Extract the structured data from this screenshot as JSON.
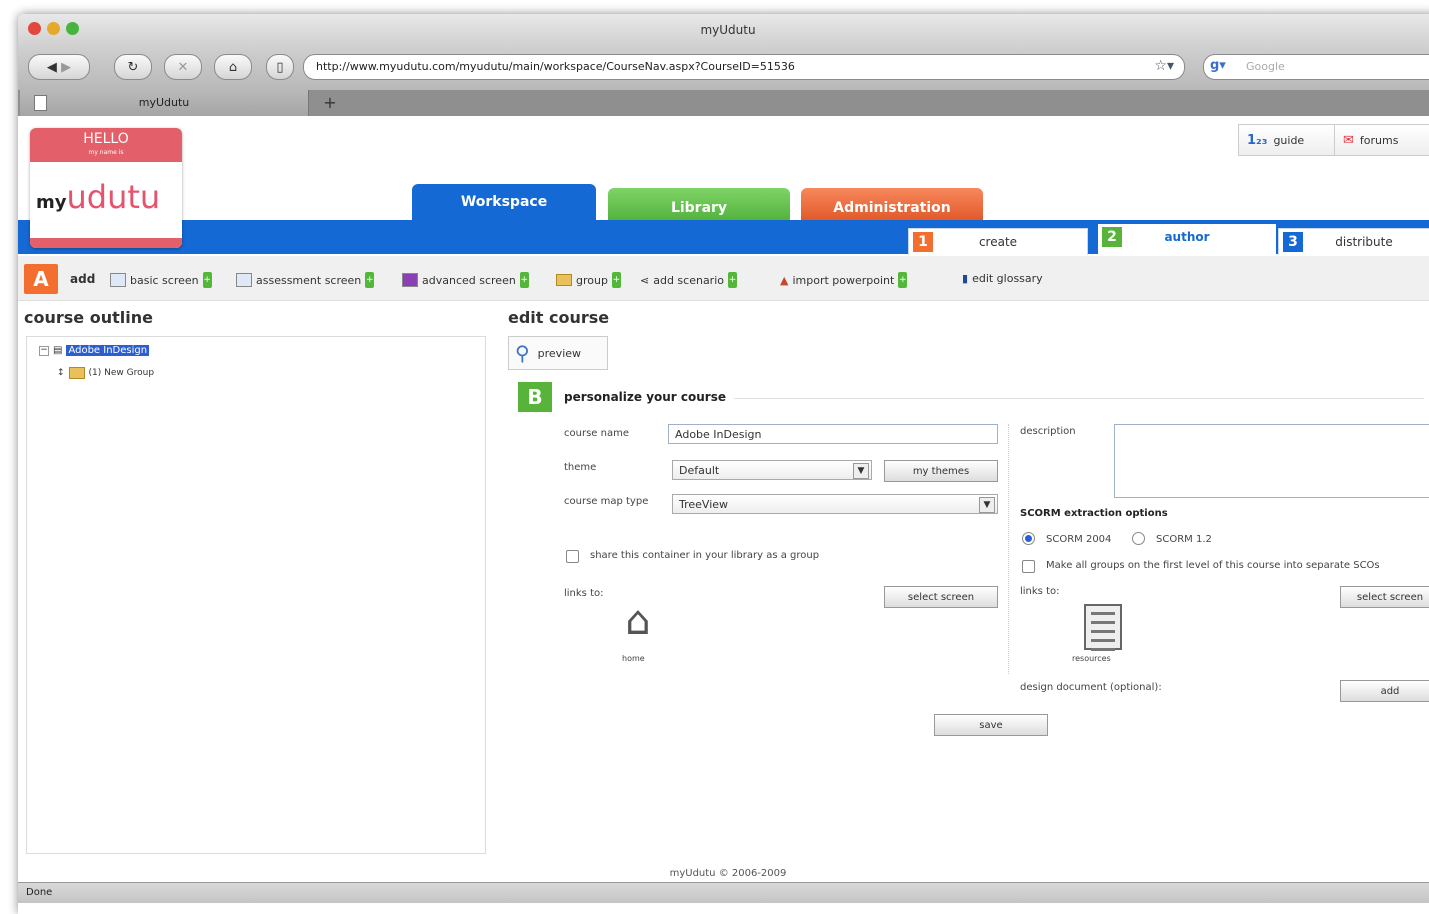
{
  "window": {
    "title": "myUdutu"
  },
  "browser": {
    "url": "http://www.myudutu.com/myudutu/main/workspace/CourseNav.aspx?CourseID=51536",
    "search_placeholder": "Google",
    "tab_label": "myUdutu",
    "status": "Done"
  },
  "header": {
    "hello_title": "HELLO",
    "hello_sub": "my name is",
    "logo_my": "my",
    "logo_name": "udutu",
    "tabs": [
      {
        "label": "Workspace",
        "color": "#1569d4"
      },
      {
        "label": "Library",
        "color": "#58b33a"
      },
      {
        "label": "Administration",
        "color": "#e9652f"
      }
    ],
    "help": [
      {
        "label": "guide"
      },
      {
        "label": "forums"
      }
    ],
    "steps": [
      {
        "num": "1",
        "label": "create",
        "color": "#f36f2f"
      },
      {
        "num": "2",
        "label": "author",
        "color": "#58b33a"
      },
      {
        "num": "3",
        "label": "distribute",
        "color": "#1569d4"
      }
    ]
  },
  "actions": {
    "badge": "A",
    "add_label": "add",
    "items": [
      {
        "label": "basic screen"
      },
      {
        "label": "assessment screen"
      },
      {
        "label": "advanced screen"
      },
      {
        "label": "group"
      },
      {
        "label": "add scenario"
      },
      {
        "label": "import powerpoint"
      },
      {
        "label": "edit glossary"
      }
    ]
  },
  "outline": {
    "title": "course outline",
    "root": "Adobe InDesign",
    "child": "(1) New Group"
  },
  "edit": {
    "title": "edit course",
    "preview": "preview",
    "badge": "B",
    "section_title": "personalize your course",
    "course_name_label": "course name",
    "course_name_value": "Adobe InDesign",
    "theme_label": "theme",
    "theme_value": "Default",
    "my_themes": "my themes",
    "map_label": "course map type",
    "map_value": "TreeView",
    "share_label": "share this container in your library as a group",
    "links_label": "links to:",
    "select_screen": "select screen",
    "home_label": "home",
    "description_label": "description",
    "scorm_title": "SCORM extraction options",
    "scorm_2004": "SCORM 2004",
    "scorm_12": "SCORM 1.2",
    "scorm_selected": "SCORM 2004",
    "separate_scos": "Make all groups on the first level of this course into separate SCOs",
    "links_label_right": "links to:",
    "select_screen_right": "select screen",
    "resources_label": "resources",
    "design_doc_label": "design document (optional):",
    "add": "add",
    "save": "save"
  },
  "footer": {
    "text": "myUdutu © 2006-2009"
  }
}
